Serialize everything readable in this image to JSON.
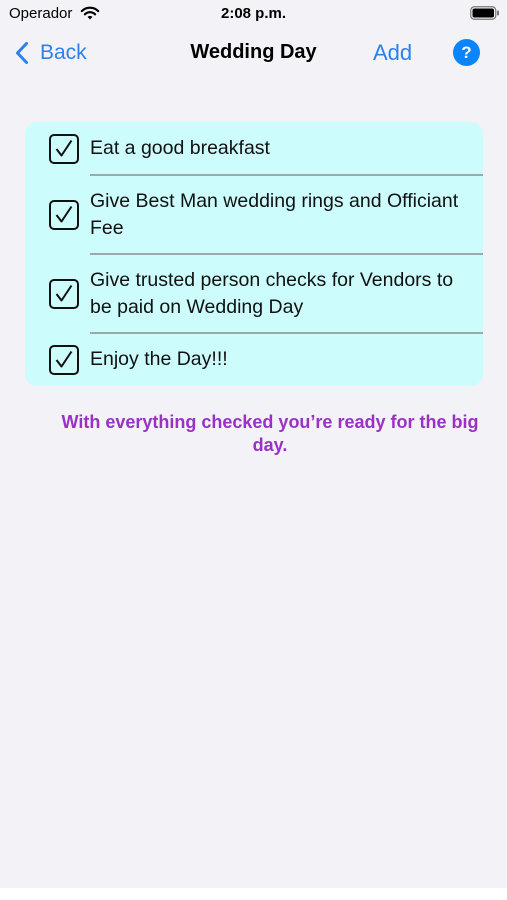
{
  "status_bar": {
    "carrier": "Operador",
    "time": "2:08 p.m."
  },
  "nav": {
    "back_label": "Back",
    "title": "Wedding Day",
    "add_label": "Add",
    "help_label": "?"
  },
  "checklist": {
    "items": [
      {
        "label": "Eat a good breakfast",
        "checked": true
      },
      {
        "label": "Give Best Man wedding rings and Officiant Fee",
        "checked": true
      },
      {
        "label": "Give trusted person checks for Vendors to be paid on Wedding Day",
        "checked": true
      },
      {
        "label": "Enjoy the Day!!!",
        "checked": true
      }
    ]
  },
  "message": "With everything checked you’re ready for the big day.",
  "colors": {
    "accent": "#2f80ed",
    "help_bg": "#0a84ff",
    "card_bg": "#ccfcfc",
    "message": "#9b30c7",
    "screen_bg": "#f2f2f7"
  }
}
